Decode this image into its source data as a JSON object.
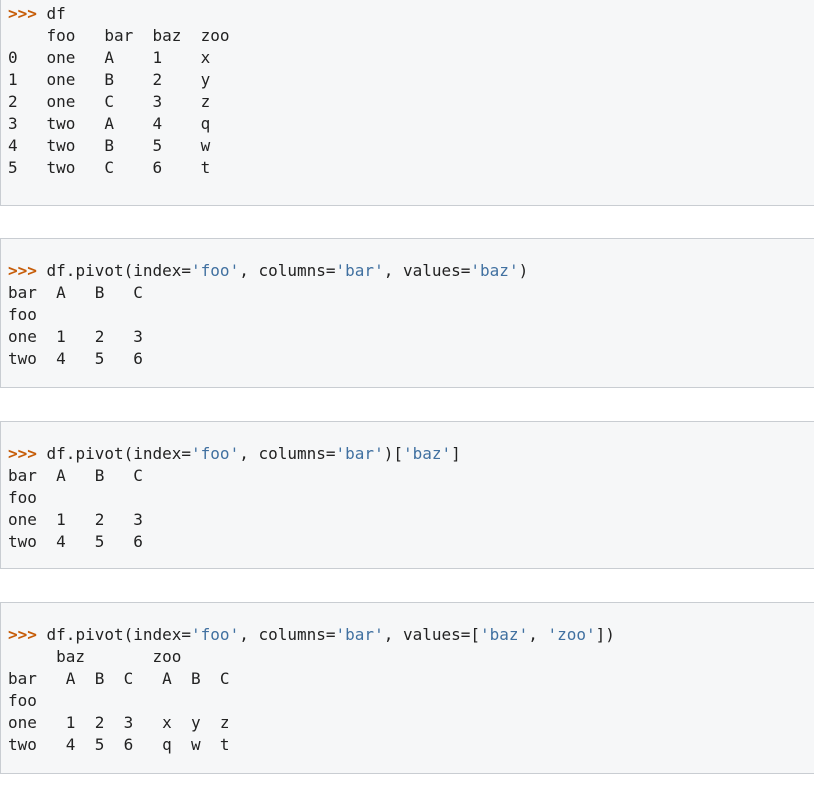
{
  "colors": {
    "prompt": "#c65d09",
    "string": "#4070a0",
    "text": "#222222",
    "block_background": "#f6f7f8",
    "block_border": "#c9cdd2"
  },
  "blocks": [
    {
      "prompt": ">>>",
      "code": [
        {
          "type": "plain",
          "text": " df"
        }
      ],
      "output": [
        "    foo   bar  baz  zoo",
        "0   one   A    1    x",
        "1   one   B    2    y",
        "2   one   C    3    z",
        "3   two   A    4    q",
        "4   two   B    5    w",
        "5   two   C    6    t"
      ]
    },
    {
      "prompt": ">>>",
      "code": [
        {
          "type": "plain",
          "text": " df.pivot(index="
        },
        {
          "type": "str",
          "text": "'foo'"
        },
        {
          "type": "plain",
          "text": ", columns="
        },
        {
          "type": "str",
          "text": "'bar'"
        },
        {
          "type": "plain",
          "text": ", values="
        },
        {
          "type": "str",
          "text": "'baz'"
        },
        {
          "type": "plain",
          "text": ")"
        }
      ],
      "output": [
        "bar  A   B   C",
        "foo",
        "one  1   2   3",
        "two  4   5   6"
      ]
    },
    {
      "prompt": ">>>",
      "code": [
        {
          "type": "plain",
          "text": " df.pivot(index="
        },
        {
          "type": "str",
          "text": "'foo'"
        },
        {
          "type": "plain",
          "text": ", columns="
        },
        {
          "type": "str",
          "text": "'bar'"
        },
        {
          "type": "plain",
          "text": ")["
        },
        {
          "type": "str",
          "text": "'baz'"
        },
        {
          "type": "plain",
          "text": "]"
        }
      ],
      "output": [
        "bar  A   B   C",
        "foo",
        "one  1   2   3",
        "two  4   5   6"
      ]
    },
    {
      "prompt": ">>>",
      "code": [
        {
          "type": "plain",
          "text": " df.pivot(index="
        },
        {
          "type": "str",
          "text": "'foo'"
        },
        {
          "type": "plain",
          "text": ", columns="
        },
        {
          "type": "str",
          "text": "'bar'"
        },
        {
          "type": "plain",
          "text": ", values=["
        },
        {
          "type": "str",
          "text": "'baz'"
        },
        {
          "type": "plain",
          "text": ", "
        },
        {
          "type": "str",
          "text": "'zoo'"
        },
        {
          "type": "plain",
          "text": "])"
        }
      ],
      "output": [
        "     baz       zoo",
        "bar   A  B  C   A  B  C",
        "foo",
        "one   1  2  3   x  y  z",
        "two   4  5  6   q  w  t"
      ]
    }
  ]
}
